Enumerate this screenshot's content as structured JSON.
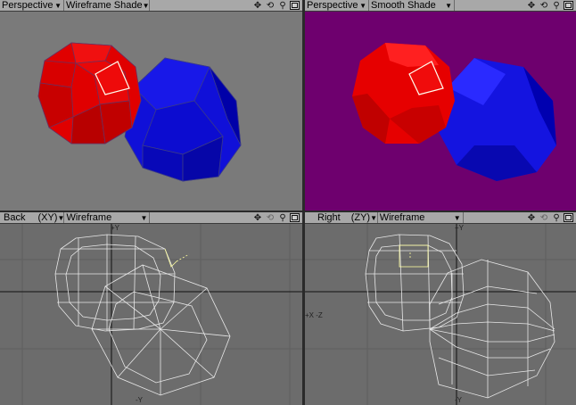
{
  "viewports": {
    "top_left": {
      "view": "Perspective",
      "mode": "Wireframe Shade"
    },
    "top_right": {
      "view": "Perspective",
      "mode": "Smooth Shade"
    },
    "bottom_left": {
      "view": "Back",
      "axes": "(XY)",
      "mode": "Wireframe",
      "axis_labels": {
        "y_top": "+Y",
        "y_bottom": "-Y"
      }
    },
    "bottom_right": {
      "view": "Right",
      "axes": "(ZY)",
      "mode": "Wireframe",
      "axis_labels": {
        "y_top": "+Y",
        "y_bottom": "-Y",
        "left": "+X -Z"
      }
    }
  },
  "icons": [
    "move-view-icon",
    "rotate-view-icon",
    "zoom-view-icon",
    "maximize-view-icon"
  ],
  "colors": {
    "header": "#a8a8a8",
    "shaded_bg": "#7a7a7a",
    "smooth_bg": "#6e006e",
    "wire_bg": "#6c6c6c",
    "red_sphere": "#e00000",
    "blue_sphere": "#0000d8",
    "wire": "#e8e8e8",
    "selection": "#ffffa0"
  }
}
